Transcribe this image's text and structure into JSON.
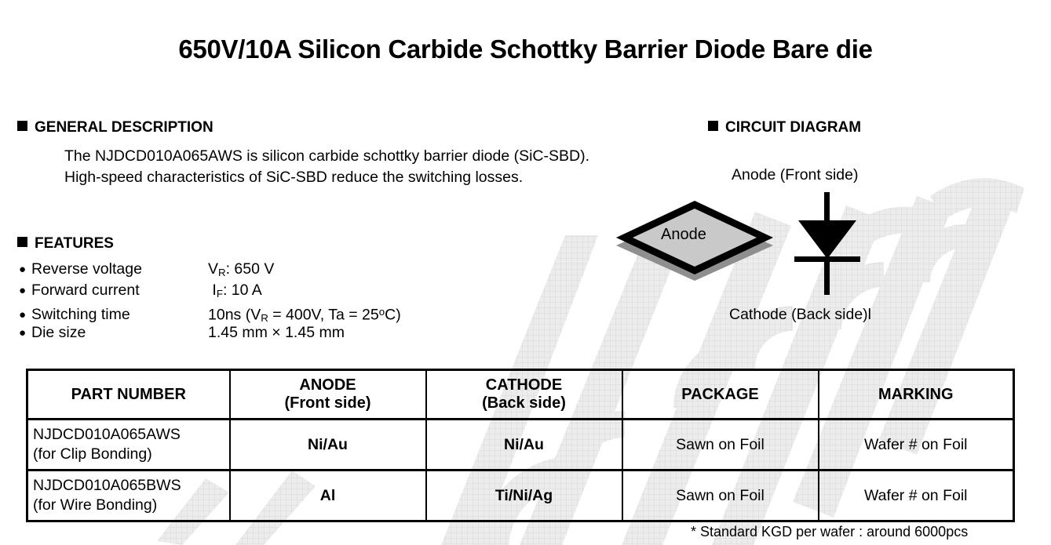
{
  "title": "650V/10A Silicon Carbide Schottky Barrier Diode Bare die",
  "sections": {
    "general_description": {
      "heading": "GENERAL DESCRIPTION",
      "line1": "The NJDCD010A065AWS is silicon carbide schottky barrier diode (SiC-SBD).",
      "line2": "High-speed characteristics of SiC-SBD reduce the switching losses."
    },
    "features": {
      "heading": "FEATURES",
      "bullet": "●",
      "items": [
        {
          "label": "Reverse voltage",
          "symbol": "V",
          "sub": "R",
          "value": ": 650 V"
        },
        {
          "label": "Forward current",
          "symbol": "I",
          "sub": "F",
          "value": ": 10 A"
        },
        {
          "label": "Switching time",
          "symbol": "",
          "sub": "",
          "value": ""
        },
        {
          "label": "Die size",
          "symbol": "",
          "sub": "",
          "value": "1.45 mm × 1.45 mm"
        }
      ],
      "switching_time": {
        "prefix": "10ns (V",
        "sub1": "R",
        "mid": " = 400V, Ta = 25",
        "sup": "o",
        "suffix": "C)"
      }
    },
    "circuit_diagram": {
      "heading": "CIRCUIT DIAGRAM",
      "anode_label": "Anode (Front side)",
      "cathode_label": "Cathode (Back side)l",
      "die_label": "Anode"
    }
  },
  "table": {
    "headers": [
      {
        "line1": "PART NUMBER",
        "line2": ""
      },
      {
        "line1": "ANODE",
        "line2": "(Front side)"
      },
      {
        "line1": "CATHODE",
        "line2": "(Back side)"
      },
      {
        "line1": "PACKAGE",
        "line2": ""
      },
      {
        "line1": "MARKING",
        "line2": ""
      }
    ],
    "rows": [
      {
        "part_number_line1": "NJDCD010A065AWS",
        "part_number_line2": "(for Clip Bonding)",
        "anode": "Ni/Au",
        "cathode": "Ni/Au",
        "package": "Sawn on Foil",
        "marking": "Wafer # on Foil"
      },
      {
        "part_number_line1": "NJDCD010A065BWS",
        "part_number_line2": "(for Wire Bonding)",
        "anode": "Al",
        "cathode": "Ti/Ni/Ag",
        "package": "Sawn on Foil",
        "marking": "Wafer # on Foil"
      }
    ]
  },
  "footnote": "* Standard KGD per wafer : around 6000pcs",
  "colors": {
    "text": "#000000",
    "background": "#ffffff",
    "die_top": "#c9c9c9",
    "die_side": "#8f8f8f",
    "die_outline": "#000000",
    "watermark": "#e9e9e9"
  }
}
